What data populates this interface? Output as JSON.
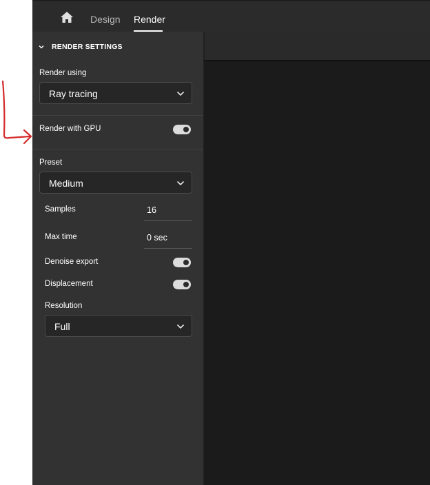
{
  "nav": {
    "home_icon": "home-icon",
    "tabs": [
      {
        "label": "Design",
        "active": false
      },
      {
        "label": "Render",
        "active": true
      }
    ]
  },
  "render_settings": {
    "section_title": "RENDER SETTINGS",
    "render_using": {
      "label": "Render using",
      "value": "Ray tracing"
    },
    "render_with_gpu": {
      "label": "Render with GPU",
      "on": true
    },
    "preset": {
      "label": "Preset",
      "value": "Medium"
    },
    "samples": {
      "label": "Samples",
      "value": "16"
    },
    "max_time": {
      "label": "Max time",
      "value": "0 sec"
    },
    "denoise_export": {
      "label": "Denoise export",
      "on": true
    },
    "displacement": {
      "label": "Displacement",
      "on": true
    },
    "resolution": {
      "label": "Resolution",
      "value": "Full"
    }
  },
  "colors": {
    "panel_bg": "#323232",
    "viewport_bg": "#1b1b1b",
    "annotation_arrow": "#d42a2a"
  }
}
